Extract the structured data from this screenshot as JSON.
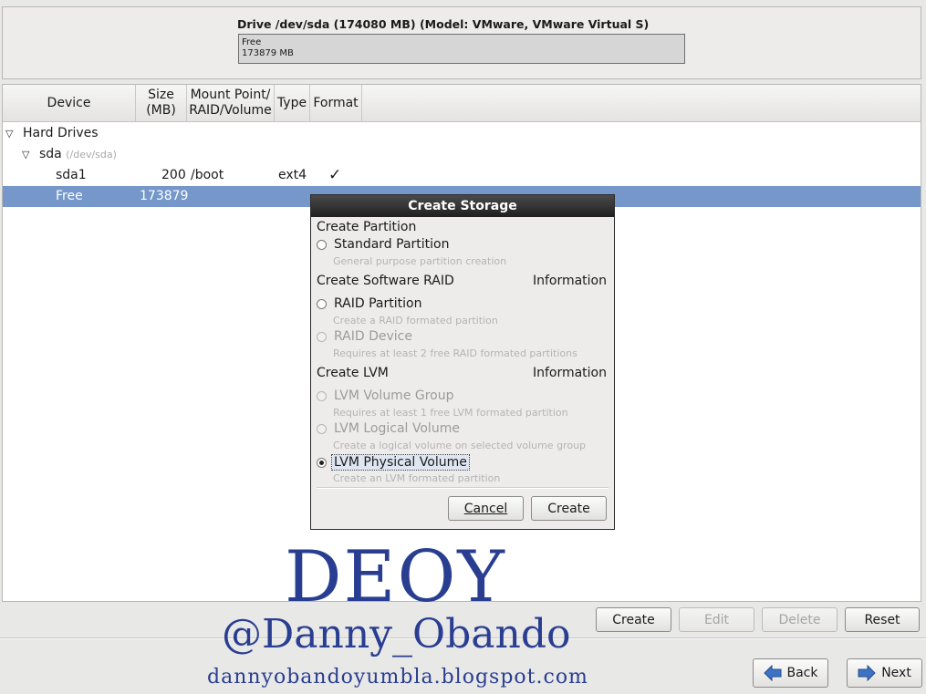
{
  "drive": {
    "title": "Drive /dev/sda (174080 MB) (Model: VMware, VMware Virtual S)",
    "bar_label": "Free",
    "bar_size": "173879 MB"
  },
  "tree": {
    "columns": {
      "device": "Device",
      "size_l1": "Size",
      "size_l2": "(MB)",
      "mount_l1": "Mount Point/",
      "mount_l2": "RAID/Volume",
      "type": "Type",
      "format": "Format"
    },
    "hard_drives": "Hard Drives",
    "sda": {
      "name": "sda",
      "path": "(/dev/sda)"
    },
    "sda1": {
      "device": "sda1",
      "size": "200",
      "mount": "/boot",
      "type": "ext4",
      "format_mark": "✓"
    },
    "free": {
      "device": "Free",
      "size": "173879"
    }
  },
  "dialog": {
    "title": "Create Storage",
    "partition_section": "Create Partition",
    "standard": {
      "label": "Standard Partition",
      "desc": "General purpose partition creation"
    },
    "raid_section": "Create Software RAID",
    "raid_info": "Information",
    "raid_partition": {
      "label": "RAID Partition",
      "desc": "Create a RAID formated partition"
    },
    "raid_device": {
      "label": "RAID Device",
      "desc": "Requires at least 2 free RAID formated partitions"
    },
    "lvm_section": "Create LVM",
    "lvm_info": "Information",
    "lvm_vg": {
      "label": "LVM Volume Group",
      "desc": "Requires at least 1 free LVM formated partition"
    },
    "lvm_lv": {
      "label": "LVM Logical Volume",
      "desc": "Create a logical volume on selected volume group"
    },
    "lvm_pv": {
      "label": "LVM Physical Volume",
      "desc": "Create an LVM formated partition"
    },
    "cancel": "Cancel",
    "create": "Create"
  },
  "actions": {
    "create": "Create",
    "edit": "Edit",
    "delete": "Delete",
    "reset": "Reset"
  },
  "nav": {
    "back": "Back",
    "next": "Next"
  },
  "watermark": {
    "logo": "DEOY",
    "handle": "@Danny_Obando",
    "site": "dannyobandoyumbla.blogspot.com"
  },
  "colors": {
    "selection": "#7597c9",
    "watermark": "#2a3e91",
    "arrow": "#3e72c4"
  }
}
